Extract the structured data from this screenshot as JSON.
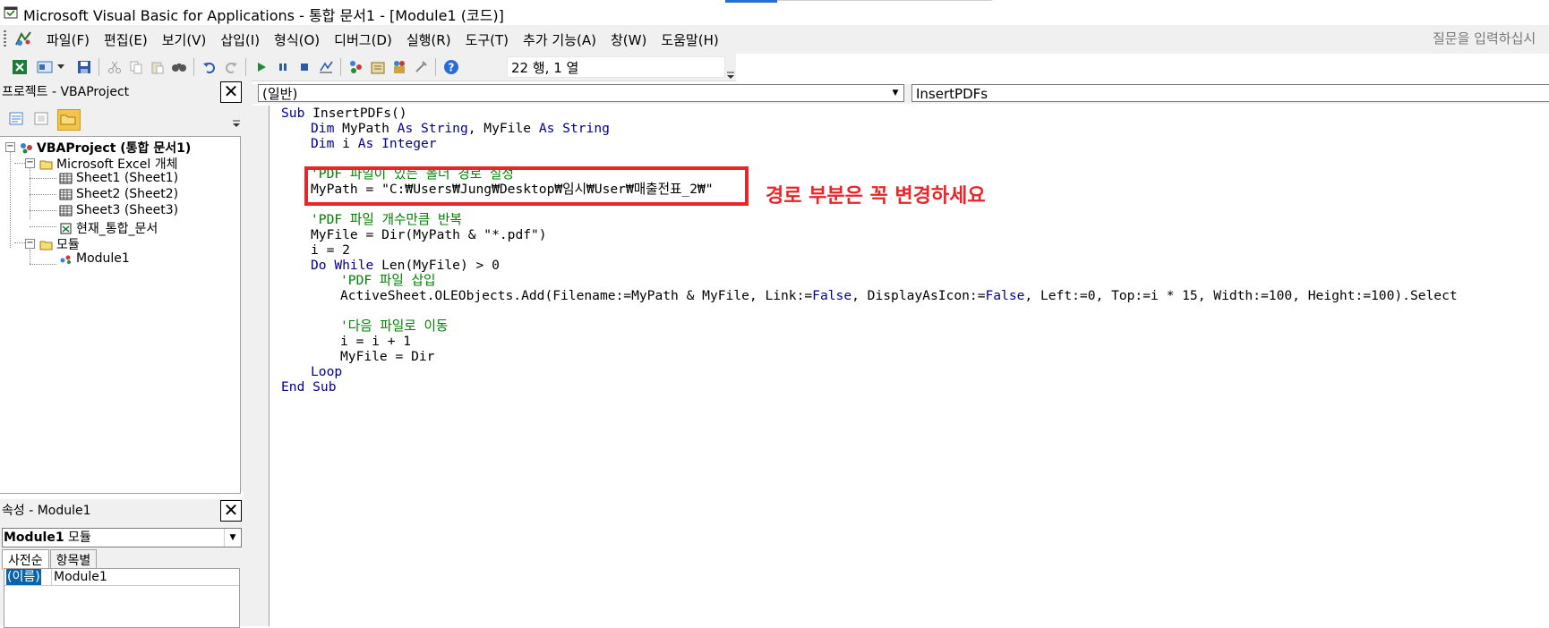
{
  "window": {
    "title": "Microsoft Visual Basic for Applications - 통합 문서1 - [Module1 (코드)]"
  },
  "menu": {
    "items": [
      "파일(F)",
      "편집(E)",
      "보기(V)",
      "삽입(I)",
      "형식(O)",
      "디버그(D)",
      "실행(R)",
      "도구(T)",
      "추가 기능(A)",
      "창(W)",
      "도움말(H)"
    ],
    "ask_placeholder": "질문을 입력하십시"
  },
  "toolbar": {
    "position_label": "22 행, 1 열",
    "icons": [
      "excel-icon",
      "insert-icon",
      "save-icon",
      "cut-icon",
      "copy-icon",
      "paste-icon",
      "find-icon",
      "undo-icon",
      "redo-icon",
      "run-icon",
      "break-icon",
      "reset-icon",
      "design-mode-icon",
      "project-explorer-icon",
      "properties-icon",
      "object-browser-icon",
      "toolbox-icon",
      "help-icon"
    ]
  },
  "project_pane": {
    "title": "프로젝트 - VBAProject",
    "root": "VBAProject (통합 문서1)",
    "folder_objects": "Microsoft Excel 개체",
    "sheets": [
      "Sheet1 (Sheet1)",
      "Sheet2 (Sheet2)",
      "Sheet3 (Sheet3)",
      "현재_통합_문서"
    ],
    "folder_modules": "모듈",
    "module": "Module1"
  },
  "properties_pane": {
    "title": "속성 - Module1",
    "combo_name": "Module1",
    "combo_type": "모듈",
    "tab_alpha": "사전순",
    "tab_category": "항목별",
    "prop_key": "(이름)",
    "prop_value": "Module1"
  },
  "code_window": {
    "object_combo": "(일반)",
    "proc_combo": "InsertPDFs",
    "annotation": "경로 부분은 꼭 변경하세요",
    "lines": [
      {
        "indent": 0,
        "segments": [
          {
            "t": "Sub",
            "k": "kw"
          },
          {
            "t": " InsertPDFs()",
            "k": ""
          }
        ]
      },
      {
        "indent": 1,
        "segments": [
          {
            "t": "Dim",
            "k": "kw"
          },
          {
            "t": " MyPath ",
            "k": ""
          },
          {
            "t": "As String",
            "k": "kw"
          },
          {
            "t": ", MyFile ",
            "k": ""
          },
          {
            "t": "As String",
            "k": "kw"
          }
        ]
      },
      {
        "indent": 1,
        "segments": [
          {
            "t": "Dim",
            "k": "kw"
          },
          {
            "t": " i ",
            "k": ""
          },
          {
            "t": "As Integer",
            "k": "kw"
          }
        ]
      },
      {
        "indent": 1,
        "segments": []
      },
      {
        "indent": 1,
        "segments": [
          {
            "t": "'PDF 파일이 있는 폴더 경로 설정",
            "k": "cm"
          }
        ]
      },
      {
        "indent": 1,
        "segments": [
          {
            "t": "MyPath = \"C:₩Users₩Jung₩Desktop₩임시₩User₩매출전표_2₩\"",
            "k": ""
          }
        ]
      },
      {
        "indent": 1,
        "segments": []
      },
      {
        "indent": 1,
        "segments": [
          {
            "t": "'PDF 파일 개수만큼 반복",
            "k": "cm"
          }
        ]
      },
      {
        "indent": 1,
        "segments": [
          {
            "t": "MyFile = Dir(MyPath & \"*.pdf\")",
            "k": ""
          }
        ]
      },
      {
        "indent": 1,
        "segments": [
          {
            "t": "i = 2",
            "k": ""
          }
        ]
      },
      {
        "indent": 1,
        "segments": [
          {
            "t": "Do While",
            "k": "kw"
          },
          {
            "t": " Len(MyFile) > 0",
            "k": ""
          }
        ]
      },
      {
        "indent": 2,
        "segments": [
          {
            "t": "'PDF 파일 삽입",
            "k": "cm"
          }
        ]
      },
      {
        "indent": 2,
        "segments": [
          {
            "t": "ActiveSheet.OLEObjects.Add(Filename:=MyPath & MyFile, Link:=",
            "k": ""
          },
          {
            "t": "False",
            "k": "kw"
          },
          {
            "t": ", DisplayAsIcon:=",
            "k": ""
          },
          {
            "t": "False",
            "k": "kw"
          },
          {
            "t": ", Left:=0, Top:=i * 15, Width:=100, Height:=100).Select",
            "k": ""
          }
        ]
      },
      {
        "indent": 2,
        "segments": []
      },
      {
        "indent": 2,
        "segments": [
          {
            "t": "'다음 파일로 이동",
            "k": "cm"
          }
        ]
      },
      {
        "indent": 2,
        "segments": [
          {
            "t": "i = i + 1",
            "k": ""
          }
        ]
      },
      {
        "indent": 2,
        "segments": [
          {
            "t": "MyFile = Dir",
            "k": ""
          }
        ]
      },
      {
        "indent": 1,
        "segments": [
          {
            "t": "Loop",
            "k": "kw"
          }
        ]
      },
      {
        "indent": 0,
        "segments": [
          {
            "t": "End Sub",
            "k": "kw"
          }
        ]
      }
    ]
  },
  "colors": {
    "keyword": "#00008b",
    "comment": "#008000",
    "annotation": "#e8262a"
  }
}
